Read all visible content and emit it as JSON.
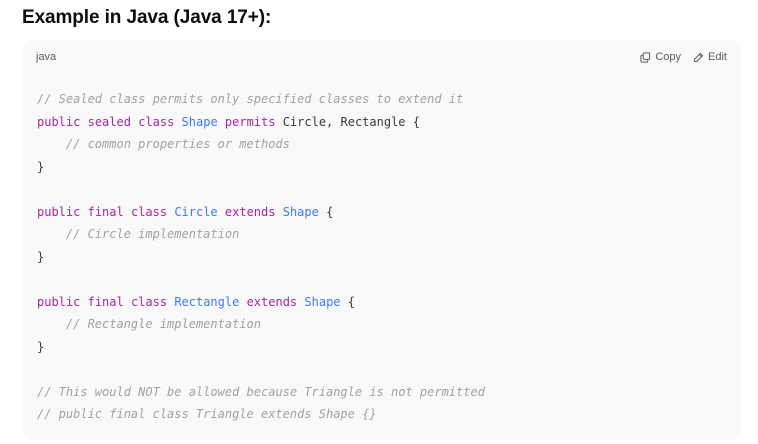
{
  "heading": "Example in Java (Java 17+):",
  "code_block": {
    "language": "java",
    "actions": {
      "copy_label": "Copy",
      "edit_label": "Edit",
      "copy_icon": "copy-icon",
      "edit_icon": "edit-icon"
    },
    "colors": {
      "keyword": "#a626a4",
      "type": "#4078f2",
      "comment": "#a0a1a7",
      "plain": "#383a42",
      "background": "#f9f9f9"
    },
    "lines": [
      [
        {
          "t": "comment",
          "v": "// Sealed class permits only specified classes to extend it"
        }
      ],
      [
        {
          "t": "keyword",
          "v": "public"
        },
        {
          "t": "plain",
          "v": " "
        },
        {
          "t": "keyword",
          "v": "sealed"
        },
        {
          "t": "plain",
          "v": " "
        },
        {
          "t": "keyword",
          "v": "class"
        },
        {
          "t": "plain",
          "v": " "
        },
        {
          "t": "type",
          "v": "Shape"
        },
        {
          "t": "plain",
          "v": " "
        },
        {
          "t": "keyword",
          "v": "permits"
        },
        {
          "t": "plain",
          "v": " Circle, Rectangle {"
        }
      ],
      [
        {
          "t": "plain",
          "v": "    "
        },
        {
          "t": "comment",
          "v": "// common properties or methods"
        }
      ],
      [
        {
          "t": "plain",
          "v": "}"
        }
      ],
      [],
      [
        {
          "t": "keyword",
          "v": "public"
        },
        {
          "t": "plain",
          "v": " "
        },
        {
          "t": "keyword",
          "v": "final"
        },
        {
          "t": "plain",
          "v": " "
        },
        {
          "t": "keyword",
          "v": "class"
        },
        {
          "t": "plain",
          "v": " "
        },
        {
          "t": "type",
          "v": "Circle"
        },
        {
          "t": "plain",
          "v": " "
        },
        {
          "t": "keyword",
          "v": "extends"
        },
        {
          "t": "plain",
          "v": " "
        },
        {
          "t": "type",
          "v": "Shape"
        },
        {
          "t": "plain",
          "v": " {"
        }
      ],
      [
        {
          "t": "plain",
          "v": "    "
        },
        {
          "t": "comment",
          "v": "// Circle implementation"
        }
      ],
      [
        {
          "t": "plain",
          "v": "}"
        }
      ],
      [],
      [
        {
          "t": "keyword",
          "v": "public"
        },
        {
          "t": "plain",
          "v": " "
        },
        {
          "t": "keyword",
          "v": "final"
        },
        {
          "t": "plain",
          "v": " "
        },
        {
          "t": "keyword",
          "v": "class"
        },
        {
          "t": "plain",
          "v": " "
        },
        {
          "t": "type",
          "v": "Rectangle"
        },
        {
          "t": "plain",
          "v": " "
        },
        {
          "t": "keyword",
          "v": "extends"
        },
        {
          "t": "plain",
          "v": " "
        },
        {
          "t": "type",
          "v": "Shape"
        },
        {
          "t": "plain",
          "v": " {"
        }
      ],
      [
        {
          "t": "plain",
          "v": "    "
        },
        {
          "t": "comment",
          "v": "// Rectangle implementation"
        }
      ],
      [
        {
          "t": "plain",
          "v": "}"
        }
      ],
      [],
      [
        {
          "t": "comment",
          "v": "// This would NOT be allowed because Triangle is not permitted"
        }
      ],
      [
        {
          "t": "comment",
          "v": "// public final class Triangle extends Shape {}"
        }
      ]
    ]
  }
}
